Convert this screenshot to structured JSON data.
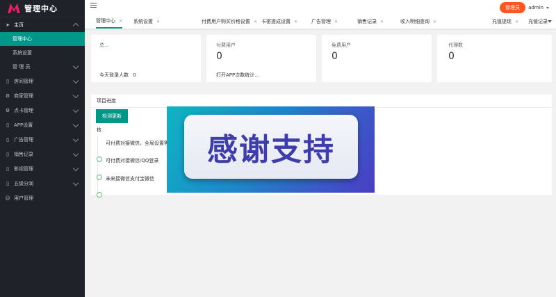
{
  "brand": {
    "title": "管理中心",
    "accent_color": "#009688",
    "logo_color": "#e91e63"
  },
  "header": {
    "badge_label": "管理员",
    "user": "admin"
  },
  "tabs": [
    {
      "label": "管理中心",
      "active": true
    },
    {
      "label": "系统设置"
    },
    {
      "label": "付费用户购买价格设置"
    },
    {
      "label": "卡密提成设置"
    },
    {
      "label": "广告管理"
    },
    {
      "label": "销售记录"
    },
    {
      "label": "收入明细查询"
    },
    {
      "label": "充值提现"
    },
    {
      "label": "充值记录"
    }
  ],
  "sidebar": {
    "home": {
      "label": "主页",
      "icon": "home-icon"
    },
    "sub": [
      {
        "label": "管理中心",
        "active": true
      },
      {
        "label": "系统设置"
      },
      {
        "label": "管 理 员"
      }
    ],
    "items": [
      {
        "label": "房间管理",
        "icon": "phone-icon"
      },
      {
        "label": "商家管理",
        "icon": "gear-icon"
      },
      {
        "label": "点卡管理",
        "icon": "gear-icon"
      },
      {
        "label": "APP设置",
        "icon": "phone-icon"
      },
      {
        "label": "广告管理",
        "icon": "phone-icon"
      },
      {
        "label": "销售记录",
        "icon": "phone-icon"
      },
      {
        "label": "影视管理",
        "icon": "phone-icon"
      },
      {
        "label": "五级分润",
        "icon": "phone-icon"
      },
      {
        "label": "用户管理",
        "icon": "user-icon"
      }
    ]
  },
  "stats": [
    {
      "title": "总...",
      "value": "",
      "footer": "今天登录人数",
      "footer_value": "0"
    },
    {
      "title": "付费用户",
      "value": "0",
      "footer": "打开APP次数统计...",
      "footer_value": ""
    },
    {
      "title": "免费用户",
      "value": "0",
      "footer": "",
      "footer_value": ""
    },
    {
      "title": "代理数",
      "value": "0",
      "footer": "",
      "footer_value": ""
    }
  ],
  "progress": {
    "title": "项目进度",
    "check_button": "检测更新",
    "timeline_label": "核",
    "timeline": [
      "可付费对接微信，全局设置等",
      "可付费对接微信/QQ登录",
      "未来接微信支付宝微信"
    ]
  },
  "overlay": {
    "text": "感谢支持"
  }
}
